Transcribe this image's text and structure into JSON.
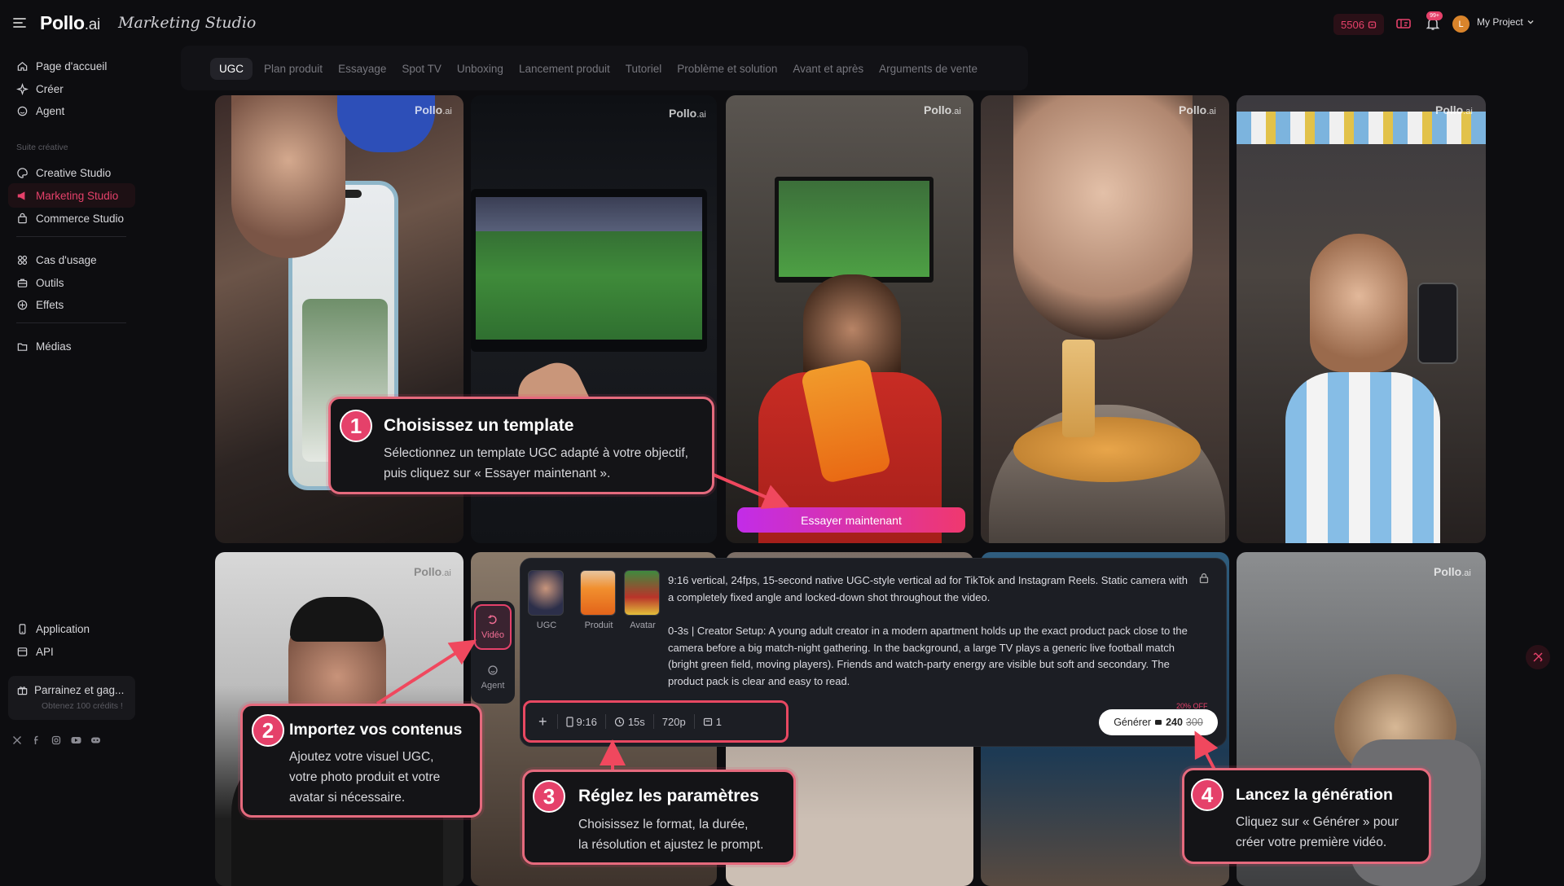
{
  "header": {
    "logo_main": "Pollo",
    "logo_suffix": ".ai",
    "studio_title": "Marketing Studio",
    "credits": "5506",
    "notifications_badge": "99+",
    "avatar_initial": "L",
    "project_label": "My Project"
  },
  "sidebar": {
    "items_top": [
      {
        "label": "Page d'accueil",
        "icon": "home-icon"
      },
      {
        "label": "Créer",
        "icon": "sparkle-icon"
      },
      {
        "label": "Agent",
        "icon": "agent-icon"
      }
    ],
    "section_label": "Suite créative",
    "items_suite": [
      {
        "label": "Creative Studio",
        "icon": "palette-icon"
      },
      {
        "label": "Marketing Studio",
        "icon": "megaphone-icon",
        "active": true
      },
      {
        "label": "Commerce Studio",
        "icon": "bag-icon"
      }
    ],
    "items_tools": [
      {
        "label": "Cas d'usage",
        "icon": "grid-icon"
      },
      {
        "label": "Outils",
        "icon": "toolbox-icon"
      },
      {
        "label": "Effets",
        "icon": "effects-icon"
      }
    ],
    "items_media": [
      {
        "label": "Médias",
        "icon": "folder-icon"
      }
    ],
    "items_bottom": [
      {
        "label": "Application",
        "icon": "phone-icon"
      },
      {
        "label": "API",
        "icon": "api-icon"
      }
    ],
    "referral": {
      "title": "Parrainez et gag...",
      "subtitle": "Obtenez 100 crédits !"
    },
    "socials": [
      "x-icon",
      "facebook-icon",
      "instagram-icon",
      "youtube-icon",
      "discord-icon"
    ]
  },
  "tabs": [
    "UGC",
    "Plan produit",
    "Essayage",
    "Spot TV",
    "Unboxing",
    "Lancement produit",
    "Tutoriel",
    "Problème et solution",
    "Avant et après",
    "Arguments de vente"
  ],
  "watermark": {
    "main": "Pollo",
    "suffix": ".ai"
  },
  "try_button": "Essayer maintenant",
  "panel": {
    "side_buttons": [
      {
        "label": "Vidéo",
        "icon": "video-icon",
        "active": true
      },
      {
        "label": "Agent",
        "icon": "agent-icon",
        "active": false
      }
    ],
    "thumbs": [
      "UGC",
      "Produit",
      "Avatar"
    ],
    "prompt_p1": "9:16 vertical, 24fps, 15-second native UGC-style vertical ad for TikTok and Instagram Reels. Static camera with a completely fixed angle and locked-down shot throughout the video.",
    "prompt_p2": "0-3s | Creator Setup: A young adult creator in a modern apartment holds up the exact product pack close to the camera before a big match-night gathering. In the background, a large TV plays a generic live football match (bright green field, moving players). Friends and watch-party energy are visible but soft and secondary. The product pack is clear and easy to read.",
    "params": {
      "ratio": "9:16",
      "duration": "15s",
      "resolution": "720p",
      "count": "1"
    },
    "discount": "20% OFF",
    "generate": {
      "label": "Générer",
      "price": "240",
      "old_price": "300"
    }
  },
  "callouts": [
    {
      "num": "1",
      "title": "Choisissez un template",
      "line1": "Sélectionnez un template UGC adapté à votre objectif,",
      "line2": "puis cliquez sur « Essayer maintenant »."
    },
    {
      "num": "2",
      "title": "Importez vos contenus",
      "line1": "Ajoutez votre visuel UGC,",
      "line2": "votre photo produit et votre",
      "line3": "avatar si nécessaire."
    },
    {
      "num": "3",
      "title": "Réglez les paramètres",
      "line1": "Choisissez le format, la durée,",
      "line2": "la résolution et ajustez le prompt."
    },
    {
      "num": "4",
      "title": "Lancez la génération",
      "line1": "Cliquez sur « Générer » pour",
      "line2": "créer votre première vidéo."
    }
  ],
  "colors": {
    "accent": "#e5416a",
    "background": "#0d0d10",
    "callout_border": "#e56a7d"
  }
}
